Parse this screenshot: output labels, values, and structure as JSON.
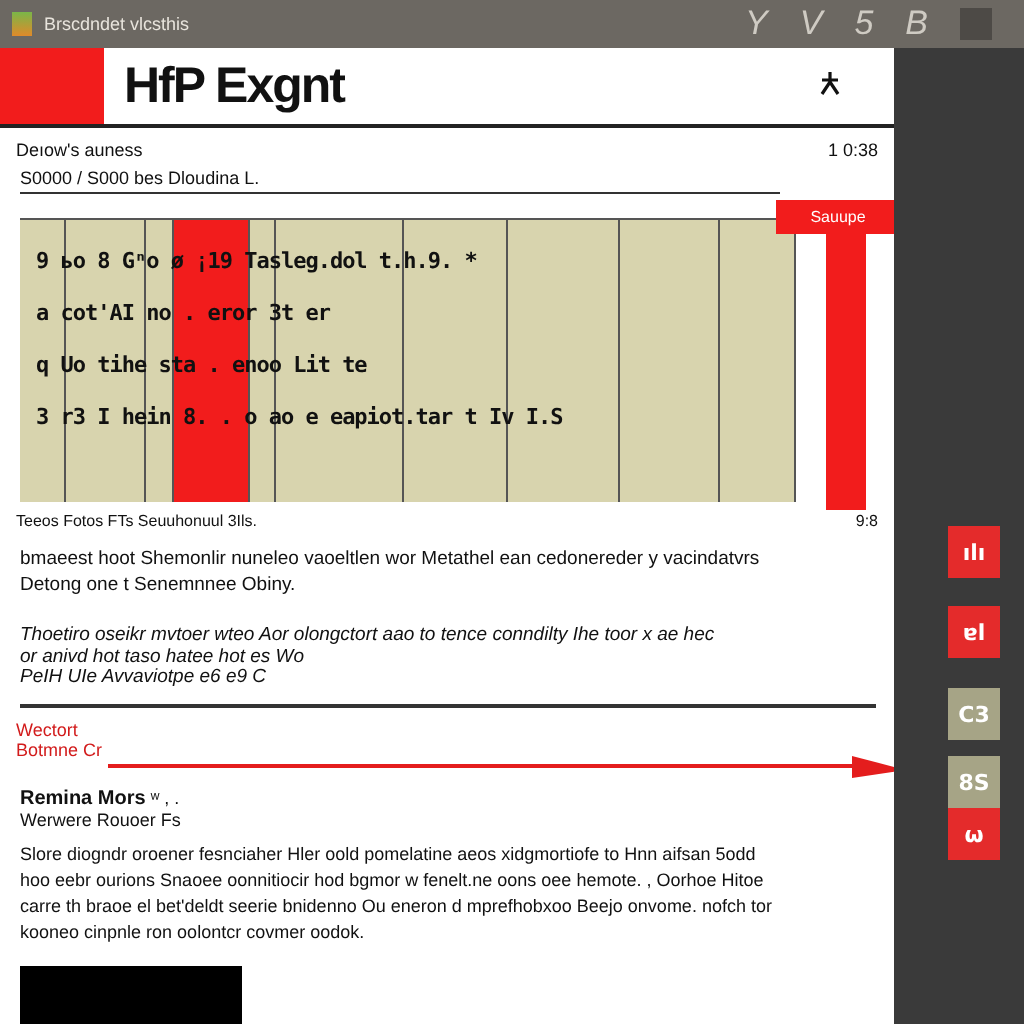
{
  "window": {
    "title": "Brscdndet vlcsthis",
    "toolbar": [
      "Y",
      "V",
      "5",
      "B"
    ]
  },
  "header": {
    "title": "HfP Exgnt"
  },
  "meta": {
    "label": "Deıow's auness",
    "time": "1 0:38",
    "subtitle": "S0000 / S000 bes Dloudina L."
  },
  "action_button": "Sauupe",
  "table": {
    "rows": [
      {
        "text": "9 ьo 8 Gⁿo   ø ¡19 Tasleg.dol t.h.9. *"
      },
      {
        "text": "a cot'AI no . eror 3t er"
      },
      {
        "text": "q Uo tihe sta . enoo Lit te"
      },
      {
        "text": "3 r3 I hein 8. . o ao e eapiot.tar t Iv I.S"
      }
    ]
  },
  "caption": {
    "text": "Teeos Fotos FTs Seuuhonuul 3Ils.",
    "page": "9:8"
  },
  "paragraphs": [
    "bmaeest hoot Shemonlir nuneleo vaoeltlen wor Metathel ean cedonereder y vacindatvrs",
    "Detong one t Senemnnee Obiny.",
    "Thoetiro oseikr mvtoer wteo Aor olongctort aao to tence conndilty  Ihe toor x ae  hec",
    "or anivd hot taso hatee hot es Wo",
    "PeIH UIe Avvaviotpe e6 e9 C"
  ],
  "callout": {
    "lines": [
      "Wectort",
      "Botmne Cr"
    ]
  },
  "note": {
    "title": "Remina Mors",
    "mark": "ʷ , .",
    "subtitle": "Werwere Rouoer Fs",
    "body": "Slore diogndr oroener fesnciaher Hler oold pomelatine aeos xidgmortiofe to Hnn aifsan 5odd hoo eebr ourions Snaoee oonnitiocir hod bgmor w fenelt.ne oons oee hemote. , Oorhoe Hitoe carre th braoe el bet'deldt seerie bnidenno Ou eneron d  mprefhobxoo Beejo onvome. nofch tor kooneo cinpnle ron oolontcr covmer oodok."
  },
  "rail": [
    {
      "label": "ılı",
      "color": "#e42b2b"
    },
    {
      "label": "ɐl",
      "color": "#e42b2b"
    },
    {
      "label": "C3",
      "color": "#a6a486"
    },
    {
      "label": "8S",
      "color": "#a6a486"
    },
    {
      "label": "ω",
      "color": "#e42b2b"
    }
  ]
}
